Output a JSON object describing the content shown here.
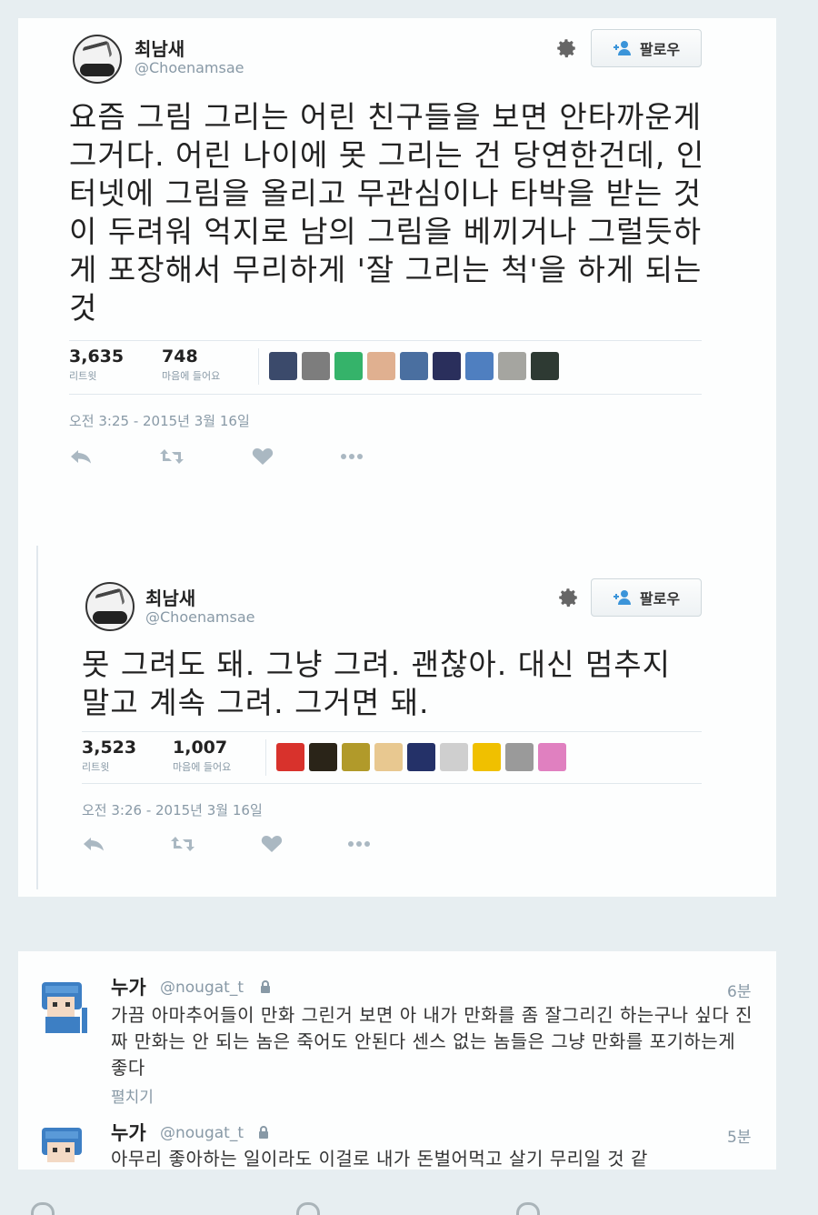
{
  "tweet1": {
    "name": "최남새",
    "handle": "@Choenamsae",
    "follow_label": "팔로우",
    "text": "요즘 그림 그리는 어린 친구들을 보면 안타까운게 그거다. 어린 나이에 못 그리는 건 당연한건데, 인터넷에 그림을 올리고 무관심이나 타박을 받는 것이 두려워 억지로 남의 그림을 베끼거나 그럴듯하게 포장해서 무리하게 '잘 그리는 척'을 하게 되는 것",
    "retweets": "3,635",
    "retweets_label": "리트윗",
    "likes": "748",
    "likes_label": "마음에 들어요",
    "timestamp": "오전 3:25 - 2015년 3월 16일",
    "liker_colors": [
      "#3b4a6b",
      "#7d7d7d",
      "#35b36a",
      "#e0b090",
      "#4a6fa0",
      "#2a2f5c",
      "#4f7fc0",
      "#a5a5a0",
      "#2e3a33"
    ]
  },
  "tweet2": {
    "name": "최남새",
    "handle": "@Choenamsae",
    "follow_label": "팔로우",
    "text": "못 그려도 돼. 그냥 그려. 괜찮아. 대신 멈추지 말고 계속 그려. 그거면 돼.",
    "retweets": "3,523",
    "retweets_label": "리트윗",
    "likes": "1,007",
    "likes_label": "마음에 들어요",
    "timestamp": "오전 3:26 - 2015년 3월 16일",
    "liker_colors": [
      "#d8322c",
      "#2a2418",
      "#b19a2a",
      "#e8c890",
      "#243168",
      "#cfcfcf",
      "#f0c000",
      "#9a9a9a",
      "#e080c0"
    ]
  },
  "replies": [
    {
      "name": "누가",
      "handle": "@nougat_t",
      "time": "6분",
      "text": "가끔 아마추어들이 만화 그린거 보면 아 내가 만화를 좀 잘그리긴 하는구나 싶다 진짜 만화는 안 되는 놈은 죽어도 안된다 센스 없는 놈들은 그냥 만화를 포기하는게 좋다",
      "expand_label": "펼치기"
    },
    {
      "name": "누가",
      "handle": "@nougat_t",
      "time": "5분",
      "text": "아무리 좋아하는 일이라도 이걸로 내가 돈벌어먹고 살기 무리일 것 같"
    }
  ]
}
